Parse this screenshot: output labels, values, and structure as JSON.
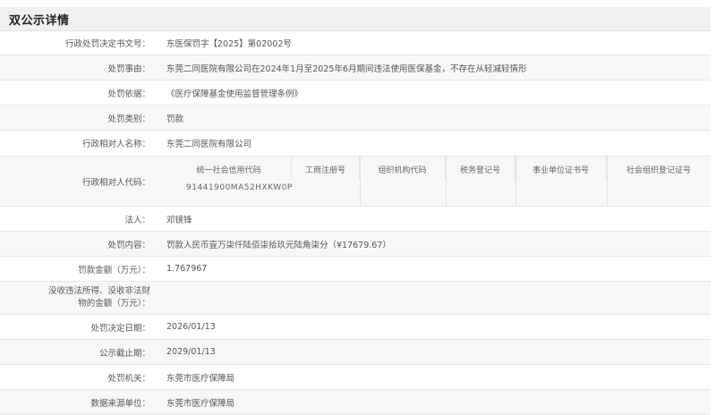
{
  "header": {
    "title": "双公示详情"
  },
  "rows": [
    {
      "label": "行政处罚决定书文号：",
      "value": "东医保罚字【2025】第02002号"
    },
    {
      "label": "处罚事由：",
      "value": "东莞二同医院有限公司在2024年1月至2025年6月期间违法使用医保基金，不存在从轻减轻情形"
    },
    {
      "label": "处罚依据：",
      "value": "《医疗保障基金使用监督管理条例》"
    },
    {
      "label": "处罚类别：",
      "value": "罚款"
    },
    {
      "label": "行政相对人名称：",
      "value": "东莞二同医院有限公司"
    },
    {
      "label": "行政相对人代码："
    },
    {
      "label": "法人：",
      "value": "邓镜锋"
    },
    {
      "label": "处罚内容：",
      "value": "罚款人民币壹万柒仟陆佰柒拾玖元陆角柒分（¥17679.67）"
    },
    {
      "label": "罚款金额（万元）：",
      "value": "1.767967"
    },
    {
      "label": "没收违法所得、没收非法财物的金额（万元）：",
      "value": ""
    },
    {
      "label": "处罚决定日期：",
      "value": "2026/01/13"
    },
    {
      "label": "公示截止期：",
      "value": "2029/01/13"
    },
    {
      "label": "处罚机关：",
      "value": "东莞市医疗保障局"
    },
    {
      "label": "数据来源单位：",
      "value": "东莞市医疗保障局"
    }
  ],
  "code_table": {
    "headers": [
      "统一社会信用代码",
      "工商注册号",
      "组织机构代码",
      "税务登记号",
      "事业单位证书号",
      "社会组织登记证号"
    ],
    "credit_code": "91441900MA52HXKW0P"
  }
}
